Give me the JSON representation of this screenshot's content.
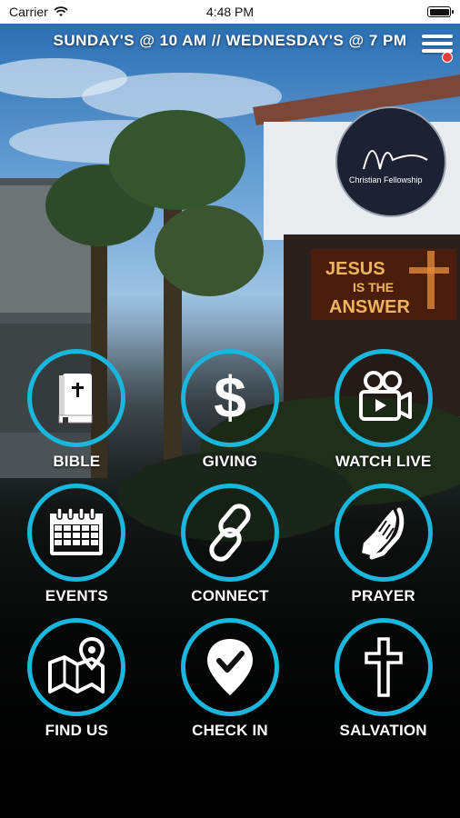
{
  "status_bar": {
    "carrier": "Carrier",
    "time": "4:48 PM"
  },
  "header": {
    "service_times": "SUNDAY'S @ 10 AM  //  WEDNESDAY'S @ 7 PM"
  },
  "sign": {
    "logo_text": "Christian Fellowship",
    "marquee_line1": "JESUS",
    "marquee_line2": "IS THE",
    "marquee_line3": "ANSWER"
  },
  "menu": [
    {
      "label": "BIBLE",
      "icon": "bible-icon"
    },
    {
      "label": "GIVING",
      "icon": "dollar-icon"
    },
    {
      "label": "WATCH LIVE",
      "icon": "video-camera-icon"
    },
    {
      "label": "EVENTS",
      "icon": "calendar-icon"
    },
    {
      "label": "CONNECT",
      "icon": "chain-link-icon"
    },
    {
      "label": "PRAYER",
      "icon": "praying-hands-icon"
    },
    {
      "label": "FIND US",
      "icon": "map-pin-icon"
    },
    {
      "label": "CHECK IN",
      "icon": "check-pin-icon"
    },
    {
      "label": "SALVATION",
      "icon": "cross-icon"
    }
  ],
  "colors": {
    "accent": "#19b6dd",
    "notification": "#ef3b3b"
  }
}
